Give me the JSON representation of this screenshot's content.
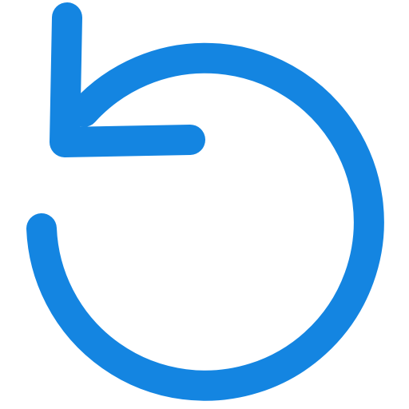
{
  "icon": {
    "name": "undo-icon",
    "color": "#1485E1"
  }
}
